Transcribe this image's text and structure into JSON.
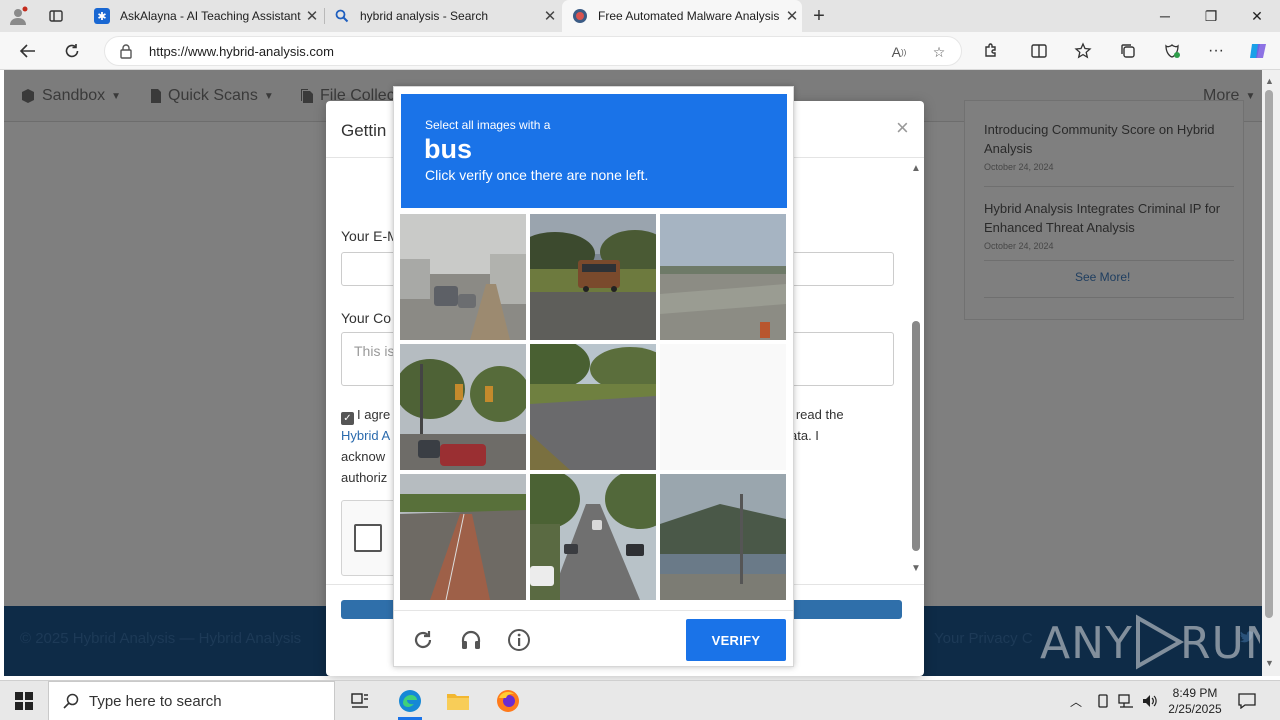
{
  "browser": {
    "tabs": [
      {
        "title": "AskAlayna - AI Teaching Assistant",
        "active": false
      },
      {
        "title": "hybrid analysis - Search",
        "active": false
      },
      {
        "title": "Free Automated Malware Analysis",
        "active": true
      }
    ],
    "new_tab": "+",
    "url": "https://www.hybrid-analysis.com",
    "window_controls": {
      "minimize": "─",
      "restore": "❐",
      "close": "✕"
    }
  },
  "site": {
    "nav": [
      {
        "label": "Sandbox"
      },
      {
        "label": "Quick Scans"
      },
      {
        "label": "File Collections"
      }
    ],
    "more": "More",
    "news": [
      {
        "title": "Introducing Community Score on Hybrid Analysis",
        "date": "October 24, 2024"
      },
      {
        "title": "Hybrid Analysis Integrates Criminal IP for Enhanced Threat Analysis",
        "date": "October 24, 2024"
      }
    ],
    "see_more": "See More!",
    "footer": {
      "copyright": "© 2025 Hybrid Analysis — Hybrid Analysis",
      "privacy": "Your Privacy C"
    }
  },
  "modal": {
    "title": "Gettin",
    "close": "×",
    "email_label": "Your E-M",
    "comment_label": "Your Co",
    "comment_placeholder": "This is",
    "agree_line1_start": "I agre",
    "agree_line1_end": "e read the",
    "agree_link": "Hybrid A",
    "agree_line2_end": "ata. I",
    "agree_line3": "acknow",
    "agree_line4": "authoriz"
  },
  "captcha": {
    "instruction": "Select all images with a",
    "object": "bus",
    "hint": "Click verify once there are none left.",
    "verify_label": "VERIFY",
    "tiles": [
      {
        "scene": "rainy street with cars",
        "blank": false
      },
      {
        "scene": "bus on sunny road",
        "blank": false
      },
      {
        "scene": "field and road",
        "blank": false
      },
      {
        "scene": "traffic lights and cars",
        "blank": false
      },
      {
        "scene": "road with trees",
        "blank": false
      },
      {
        "scene": "blank",
        "blank": true
      },
      {
        "scene": "bike lane road",
        "blank": false
      },
      {
        "scene": "street with parked cars",
        "blank": false
      },
      {
        "scene": "waterfront road",
        "blank": false
      }
    ],
    "footer_icons": [
      "reload-icon",
      "audio-icon",
      "info-icon"
    ]
  },
  "watermark": "ANY RUN",
  "taskbar": {
    "search_placeholder": "Type here to search",
    "time": "8:49 PM",
    "date": "2/25/2025"
  }
}
